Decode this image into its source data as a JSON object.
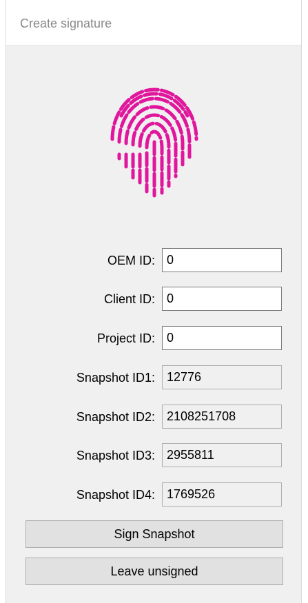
{
  "window": {
    "title": "Create signature"
  },
  "logo": {
    "icon": "fingerprint-icon",
    "color": "#e0179c"
  },
  "form": {
    "oem_id": {
      "label": "OEM ID:",
      "value": "0"
    },
    "client_id": {
      "label": "Client ID:",
      "value": "0"
    },
    "project_id": {
      "label": "Project ID:",
      "value": "0"
    },
    "snapshot_id1": {
      "label": "Snapshot ID1:",
      "value": "12776"
    },
    "snapshot_id2": {
      "label": "Snapshot ID2:",
      "value": "2108251708"
    },
    "snapshot_id3": {
      "label": "Snapshot ID3:",
      "value": "2955811"
    },
    "snapshot_id4": {
      "label": "Snapshot ID4:",
      "value": "1769526"
    }
  },
  "buttons": {
    "sign": "Sign Snapshot",
    "leave": "Leave unsigned"
  }
}
